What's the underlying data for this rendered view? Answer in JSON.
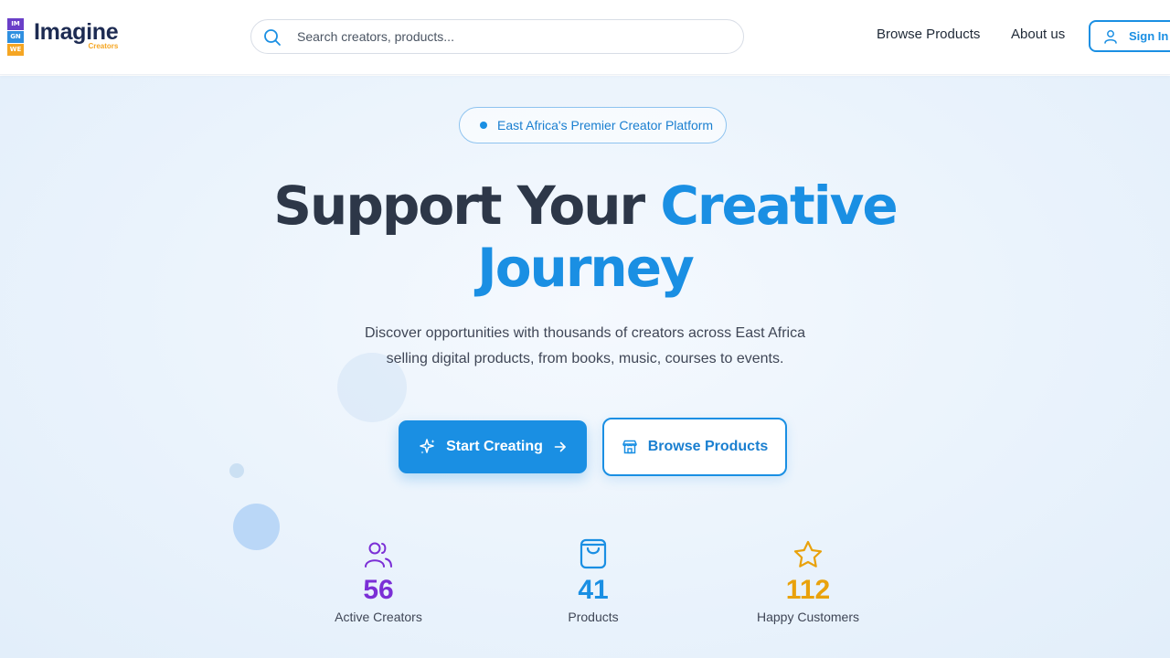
{
  "brand": {
    "mark_rows": [
      "IM",
      "GN",
      "WE"
    ],
    "name": "Imagine",
    "sub": "Creators"
  },
  "search": {
    "placeholder": "Search creators, products..."
  },
  "nav": {
    "browse": "Browse Products",
    "about": "About us",
    "signin": "Sign In"
  },
  "hero": {
    "badge": "East Africa's Premier Creator Platform",
    "headline_dark": "Support Your",
    "headline_blue_1": "Creative",
    "headline_blue_2": "Journey",
    "subtitle_line1": "Discover opportunities with thousands of creators across East Africa",
    "subtitle_line2": "selling digital products, from books, music, courses to events.",
    "start_button": "Start Creating",
    "browse_button": "Browse Products"
  },
  "stats": [
    {
      "icon": "users-icon",
      "value": "56",
      "label": "Active Creators",
      "color": "#7b2fd6"
    },
    {
      "icon": "shopping-bag-icon",
      "value": "41",
      "label": "Products",
      "color": "#1a8fe3"
    },
    {
      "icon": "star-icon",
      "value": "112",
      "label": "Happy Customers",
      "color": "#e9a20c"
    }
  ],
  "colors": {
    "primary": "#1a8fe3",
    "heading_dark": "#2d3748",
    "purple": "#7b2fd6",
    "gold": "#e9a20c"
  }
}
